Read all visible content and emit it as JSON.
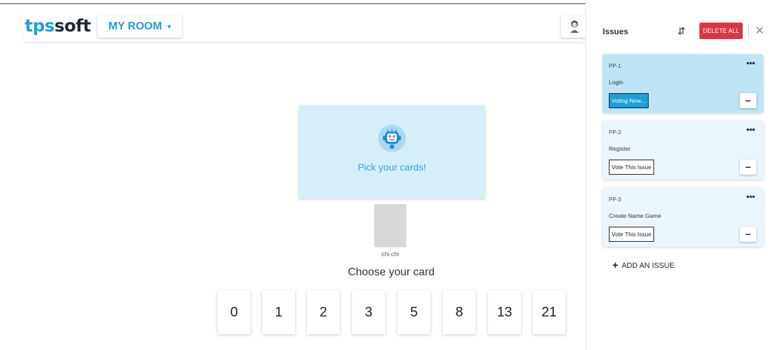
{
  "header": {
    "logo_part1": "tps",
    "logo_part2": "soft",
    "room_label": "MY ROOM",
    "caret_icon": "caret-down-icon",
    "avatar_icon": "user-avatar-icon"
  },
  "table": {
    "pick_text": "Pick your cards!",
    "robot_icon": "robot-icon"
  },
  "player": {
    "name": "chi chi"
  },
  "deck": {
    "prompt": "Choose your card",
    "cards": [
      "0",
      "1",
      "2",
      "3",
      "5",
      "8",
      "13",
      "21"
    ]
  },
  "sidebar": {
    "title": "Issues",
    "delete_all_label": "DELETE ALL",
    "shuffle_icon": "shuffle-icon",
    "close_icon": "close-icon",
    "issues": [
      {
        "key": "PP-1",
        "name": "Login",
        "vote_label": "Voting Now...",
        "active": true
      },
      {
        "key": "PP-2",
        "name": "Register",
        "vote_label": "Vote This Issue",
        "active": false
      },
      {
        "key": "PP-3",
        "name": "Create Name Game",
        "vote_label": "Vote This Issue",
        "active": false
      }
    ],
    "add_issue_label": "ADD AN ISSUE"
  },
  "colors": {
    "brand": "#1aa0db",
    "danger": "#dc3545",
    "active_issue": "#bde5f6",
    "idle_issue": "#eaf6fd",
    "table": "#d6eef9"
  }
}
